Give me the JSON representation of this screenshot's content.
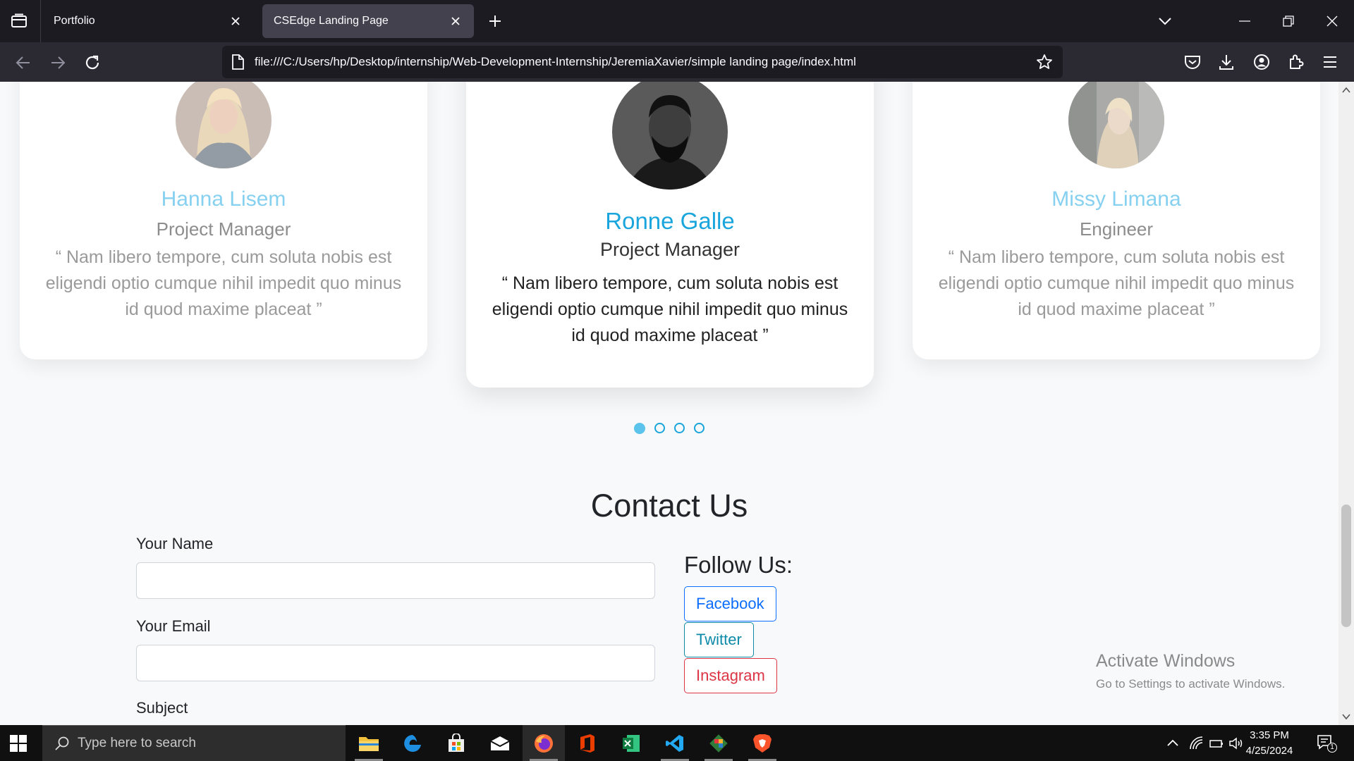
{
  "browser": {
    "tabs": [
      {
        "title": "Portfolio",
        "active": false
      },
      {
        "title": "CSEdge Landing Page",
        "active": true
      }
    ],
    "url": "file:///C:/Users/hp/Desktop/internship/Web-Development-Internship/JeremiaXavier/simple landing page/index.html"
  },
  "testimonials": [
    {
      "name": "Hanna Lisem",
      "role": "Project Manager",
      "quote": "“ Nam libero tempore, cum soluta nobis est eligendi optio cumque nihil impedit quo minus id quod maxime placeat ”",
      "avatar": "blonde-woman-avatar"
    },
    {
      "name": "Ronne Galle",
      "role": "Project Manager",
      "quote": "“ Nam libero tempore, cum soluta nobis est eligendi optio cumque nihil impedit quo minus id quod maxime placeat ”",
      "avatar": "bearded-man-avatar"
    },
    {
      "name": "Missy Limana",
      "role": "Engineer",
      "quote": "“ Nam libero tempore, cum soluta nobis est eligendi optio cumque nihil impedit quo minus id quod maxime placeat ”",
      "avatar": "woman-street-avatar"
    }
  ],
  "carousel": {
    "slides": 4,
    "active_index": 0
  },
  "contact": {
    "title": "Contact Us",
    "name_label": "Your Name",
    "email_label": "Your Email",
    "subject_label": "Subject",
    "name_value": "",
    "email_value": ""
  },
  "follow": {
    "title": "Follow Us:",
    "facebook": "Facebook",
    "twitter": "Twitter",
    "instagram": "Instagram"
  },
  "colors": {
    "facebook": "#0d6efd",
    "twitter": "#0d8aa8",
    "instagram": "#dc3545",
    "accent": "#1aa6dd"
  },
  "watermark": {
    "line1": "Activate Windows",
    "line2": "Go to Settings to activate Windows."
  },
  "taskbar": {
    "search_placeholder": "Type here to search",
    "time": "3:35 PM",
    "date": "4/25/2024",
    "notifications": "1",
    "apps": [
      "file-explorer",
      "edge",
      "microsoft-store",
      "mail",
      "firefox",
      "office",
      "excel",
      "vscode",
      "git",
      "brave"
    ]
  }
}
